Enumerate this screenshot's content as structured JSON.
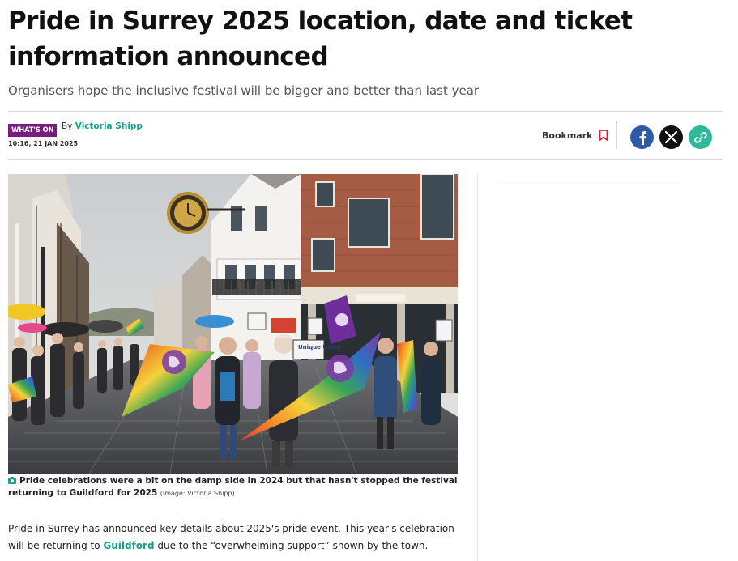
{
  "article": {
    "headline": "Pride in Surrey 2025 location, date and ticket information announced",
    "standfirst": "Organisers hope the inclusive festival will be bigger and better than last year",
    "section": "WHAT'S ON",
    "byline_prefix": "By",
    "author": "Victoria Shipp",
    "timestamp": "10:16, 21 JAN 2025"
  },
  "actions": {
    "bookmark_label": "Bookmark",
    "share": [
      {
        "name": "facebook",
        "icon": "facebook-icon",
        "color": "#2e5aa8"
      },
      {
        "name": "x",
        "icon": "x-icon",
        "color": "#111111"
      },
      {
        "name": "copy-link",
        "icon": "link-icon",
        "color": "#2fb89a"
      }
    ]
  },
  "image": {
    "alt": "Pride in Surrey march on a rainy Guildford high street",
    "caption": "Pride celebrations were a bit on the damp side in 2024 but that hasn't stopped the festival returning to Guildford for 2025",
    "credit": "(Image: Victoria Shipp)",
    "sign_text": "Unique Union"
  },
  "body": {
    "p1_before_link": "Pride in Surrey has announced key details about 2025's pride event. This year's celebration will be returning to ",
    "p1_link": "Guildford",
    "p1_after_link": " due to the “overwhelming support” shown by the town."
  },
  "colors": {
    "accent": "#1a9e8c",
    "section_badge": "#7a1c7e",
    "bookmark_icon": "#d0233d"
  }
}
